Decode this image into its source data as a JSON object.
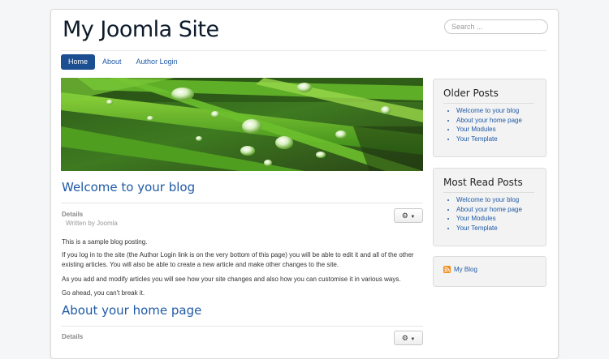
{
  "site": {
    "title": "My Joomla Site"
  },
  "search": {
    "placeholder": "Search ..."
  },
  "nav": {
    "items": [
      {
        "label": "Home",
        "active": true
      },
      {
        "label": "About"
      },
      {
        "label": "Author Login"
      }
    ]
  },
  "articles": [
    {
      "title": "Welcome to your blog",
      "details_label": "Details",
      "author": "Written by Joomla",
      "paragraphs": [
        "This is a sample blog posting.",
        "If you log in to the site (the Author Login link is on the very bottom of this page) you will be able to edit it and all of the other existing articles. You will also be able to create a new article and make other changes to the site.",
        "As you add and modify articles you will see how your site changes and also how you can customise it in various ways.",
        "Go ahead, you can't break it."
      ]
    },
    {
      "title": "About your home page",
      "details_label": "Details"
    }
  ],
  "sidebar": {
    "older_posts": {
      "title": "Older Posts",
      "items": [
        "Welcome to your blog",
        "About your home page",
        "Your Modules",
        "Your Template"
      ]
    },
    "most_read": {
      "title": "Most Read Posts",
      "items": [
        "Welcome to your blog",
        "About your home page",
        "Your Modules",
        "Your Template"
      ]
    },
    "feed": {
      "label": "My Blog",
      "icon": "rss-icon"
    }
  },
  "colors": {
    "accent": "#1b4f91",
    "link": "#1f5aa6",
    "title": "#0d1b2a"
  }
}
